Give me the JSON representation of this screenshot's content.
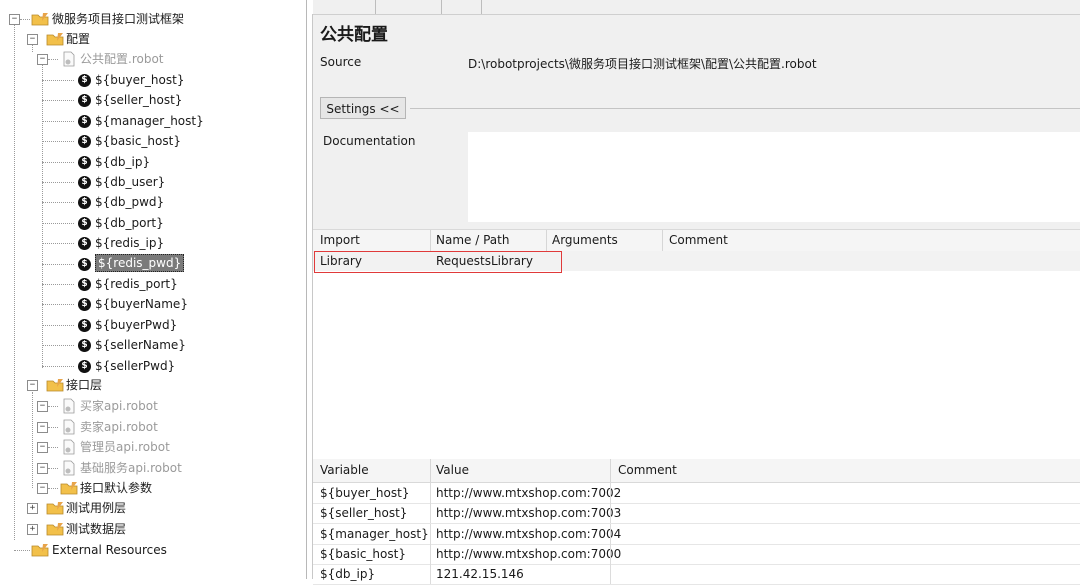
{
  "tree": {
    "root": "微服务项目接口测试框架",
    "config_folder": "配置",
    "config_file": "公共配置.robot",
    "variables": [
      "${buyer_host}",
      "${seller_host}",
      "${manager_host}",
      "${basic_host}",
      "${db_ip}",
      "${db_user}",
      "${db_pwd}",
      "${db_port}",
      "${redis_ip}",
      "${redis_pwd}",
      "${redis_port}",
      "${buyerName}",
      "${buyerPwd}",
      "${sellerName}",
      "${sellerPwd}"
    ],
    "selected_variable": "${redis_pwd}",
    "interface_folder": "接口层",
    "interface_files": [
      "买家api.robot",
      "卖家api.robot",
      "管理员api.robot",
      "基础服务api.robot"
    ],
    "interface_defaults": "接口默认参数",
    "testcase_folder": "测试用例层",
    "testdata_folder": "测试数据层",
    "external": "External Resources"
  },
  "panel": {
    "title": "公共配置",
    "source_label": "Source",
    "source_value": "D:\\robotprojects\\微服务项目接口测试框架\\配置\\公共配置.robot",
    "settings_button": "Settings <<",
    "documentation_label": "Documentation",
    "documentation_value": ""
  },
  "imports": {
    "headers": [
      "Import",
      "Name / Path",
      "Arguments",
      "Comment"
    ],
    "rows": [
      [
        "Library",
        "RequestsLibrary",
        "",
        ""
      ]
    ]
  },
  "variables_table": {
    "headers": [
      "Variable",
      "Value",
      "Comment"
    ],
    "rows": [
      [
        "${buyer_host}",
        "http://www.mtxshop.com:7002",
        ""
      ],
      [
        "${seller_host}",
        "http://www.mtxshop.com:7003",
        ""
      ],
      [
        "${manager_host}",
        "http://www.mtxshop.com:7004",
        ""
      ],
      [
        "${basic_host}",
        "http://www.mtxshop.com:7000",
        ""
      ],
      [
        "${db_ip}",
        "121.42.15.146",
        ""
      ]
    ]
  },
  "colors": {
    "highlight_border": "#e03a3a",
    "folder": "#f2c04a",
    "selected_bg": "#7a7a7a"
  }
}
